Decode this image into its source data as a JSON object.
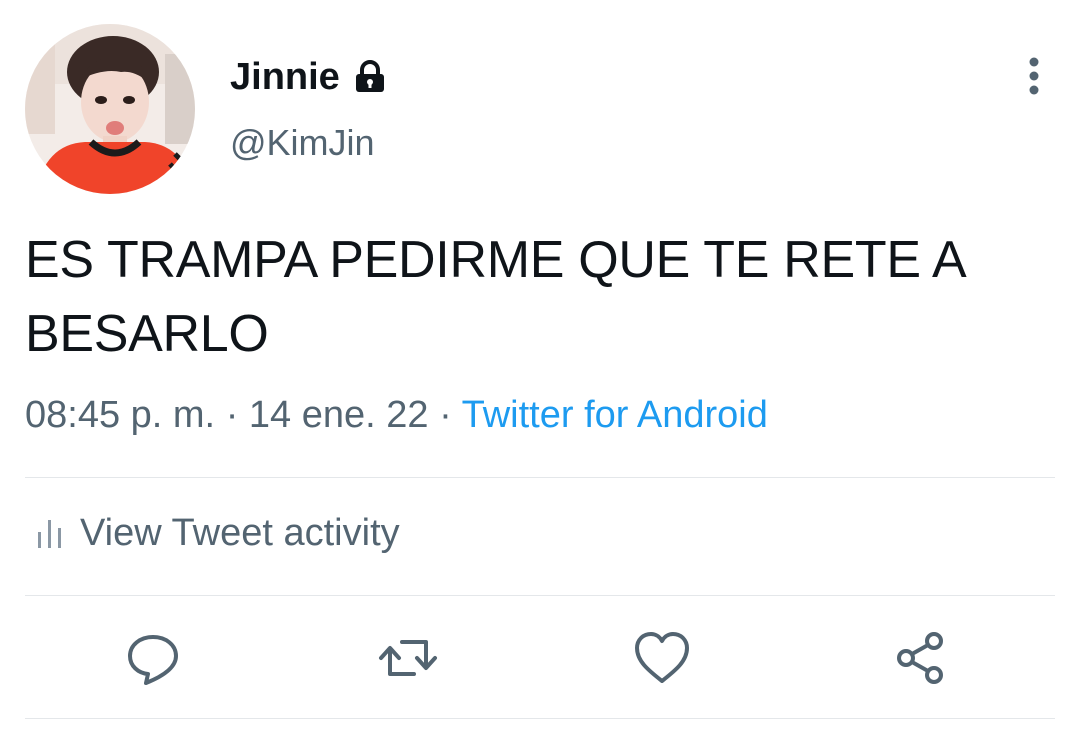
{
  "user": {
    "display_name": "Jinnie",
    "handle": "@KimJin",
    "protected_icon": "lock-icon",
    "avatar": "profile-photo"
  },
  "tweet": {
    "text": "ES TRAMPA PEDIRME QUE TE RETE A BESARLO",
    "time": "08:45 p. m.",
    "separator": "·",
    "date": "14 ene. 22",
    "source": "Twitter for Android"
  },
  "activity": {
    "label": "View Tweet activity",
    "icon": "bar-chart-icon"
  },
  "actions": {
    "reply_icon": "reply-icon",
    "retweet_icon": "retweet-icon",
    "like_icon": "heart-icon",
    "share_icon": "share-icon",
    "more_icon": "more-vertical-icon"
  },
  "colors": {
    "text": "#0f1419",
    "secondary": "#536471",
    "link": "#1d9bf0",
    "divider": "#e4e7ea"
  }
}
